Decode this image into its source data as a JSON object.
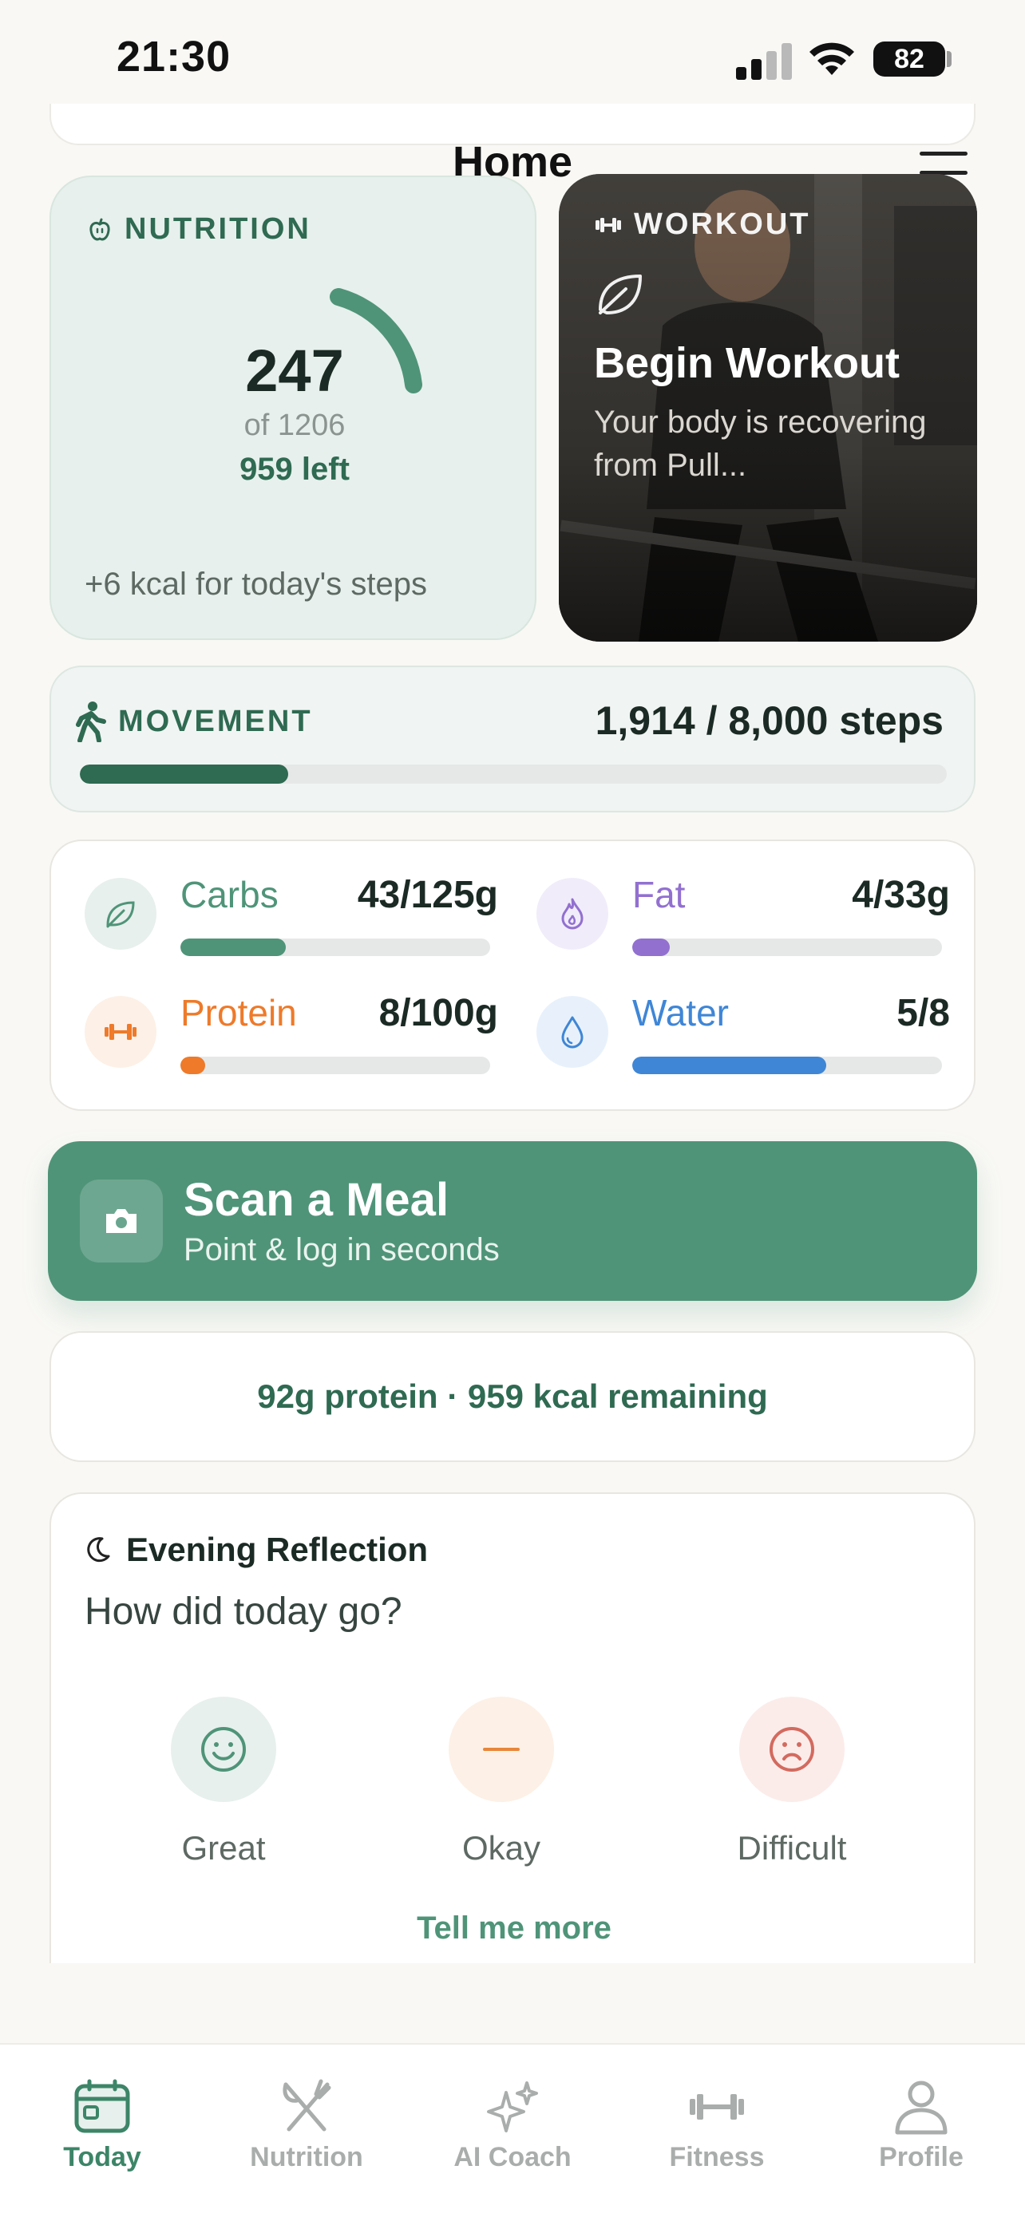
{
  "status_bar": {
    "time": "21:30",
    "battery": "82"
  },
  "header": {
    "title": "Home"
  },
  "nutrition": {
    "label": "NUTRITION",
    "consumed": "247",
    "goal_text": "of 1206",
    "left_text": "959 left",
    "steps_bonus": "+6 kcal for today's steps"
  },
  "workout": {
    "label": "WORKOUT",
    "title": "Begin Workout",
    "subtitle": "Your body is recovering from Pull..."
  },
  "movement": {
    "label": "MOVEMENT",
    "steps_text": "1,914 / 8,000 steps",
    "progress": 0.24
  },
  "macros": [
    {
      "name": "Carbs",
      "value": "43/125g",
      "progress": 0.34,
      "color": "#4f9479",
      "icon": "leaf-icon"
    },
    {
      "name": "Fat",
      "value": "4/33g",
      "progress": 0.12,
      "color": "#9270d0",
      "icon": "flame-icon"
    },
    {
      "name": "Protein",
      "value": "8/100g",
      "progress": 0.08,
      "color": "#ee7a2a",
      "icon": "dumbbell-icon"
    },
    {
      "name": "Water",
      "value": "5/8",
      "progress": 0.625,
      "color": "#3f86d6",
      "icon": "water-drop-icon"
    }
  ],
  "scan": {
    "title": "Scan a Meal",
    "subtitle": "Point & log in seconds"
  },
  "remaining": {
    "text": "92g protein · 959 kcal remaining"
  },
  "reflection": {
    "title": "Evening Reflection",
    "question": "How did today go?",
    "options": [
      "Great",
      "Okay",
      "Difficult"
    ],
    "more_link": "Tell me more"
  },
  "tabs": [
    {
      "label": "Today",
      "active": true,
      "icon": "calendar-icon"
    },
    {
      "label": "Nutrition",
      "active": false,
      "icon": "fork-knife-icon"
    },
    {
      "label": "AI Coach",
      "active": false,
      "icon": "sparkles-icon"
    },
    {
      "label": "Fitness",
      "active": false,
      "icon": "dumbbell-icon"
    },
    {
      "label": "Profile",
      "active": false,
      "icon": "person-icon"
    }
  ],
  "colors": {
    "brand_green": "#4f9479",
    "dark_green": "#2f6a52",
    "carbs": "#4f9479",
    "fat": "#9270d0",
    "protein": "#ee7a2a",
    "water": "#3f86d6"
  }
}
